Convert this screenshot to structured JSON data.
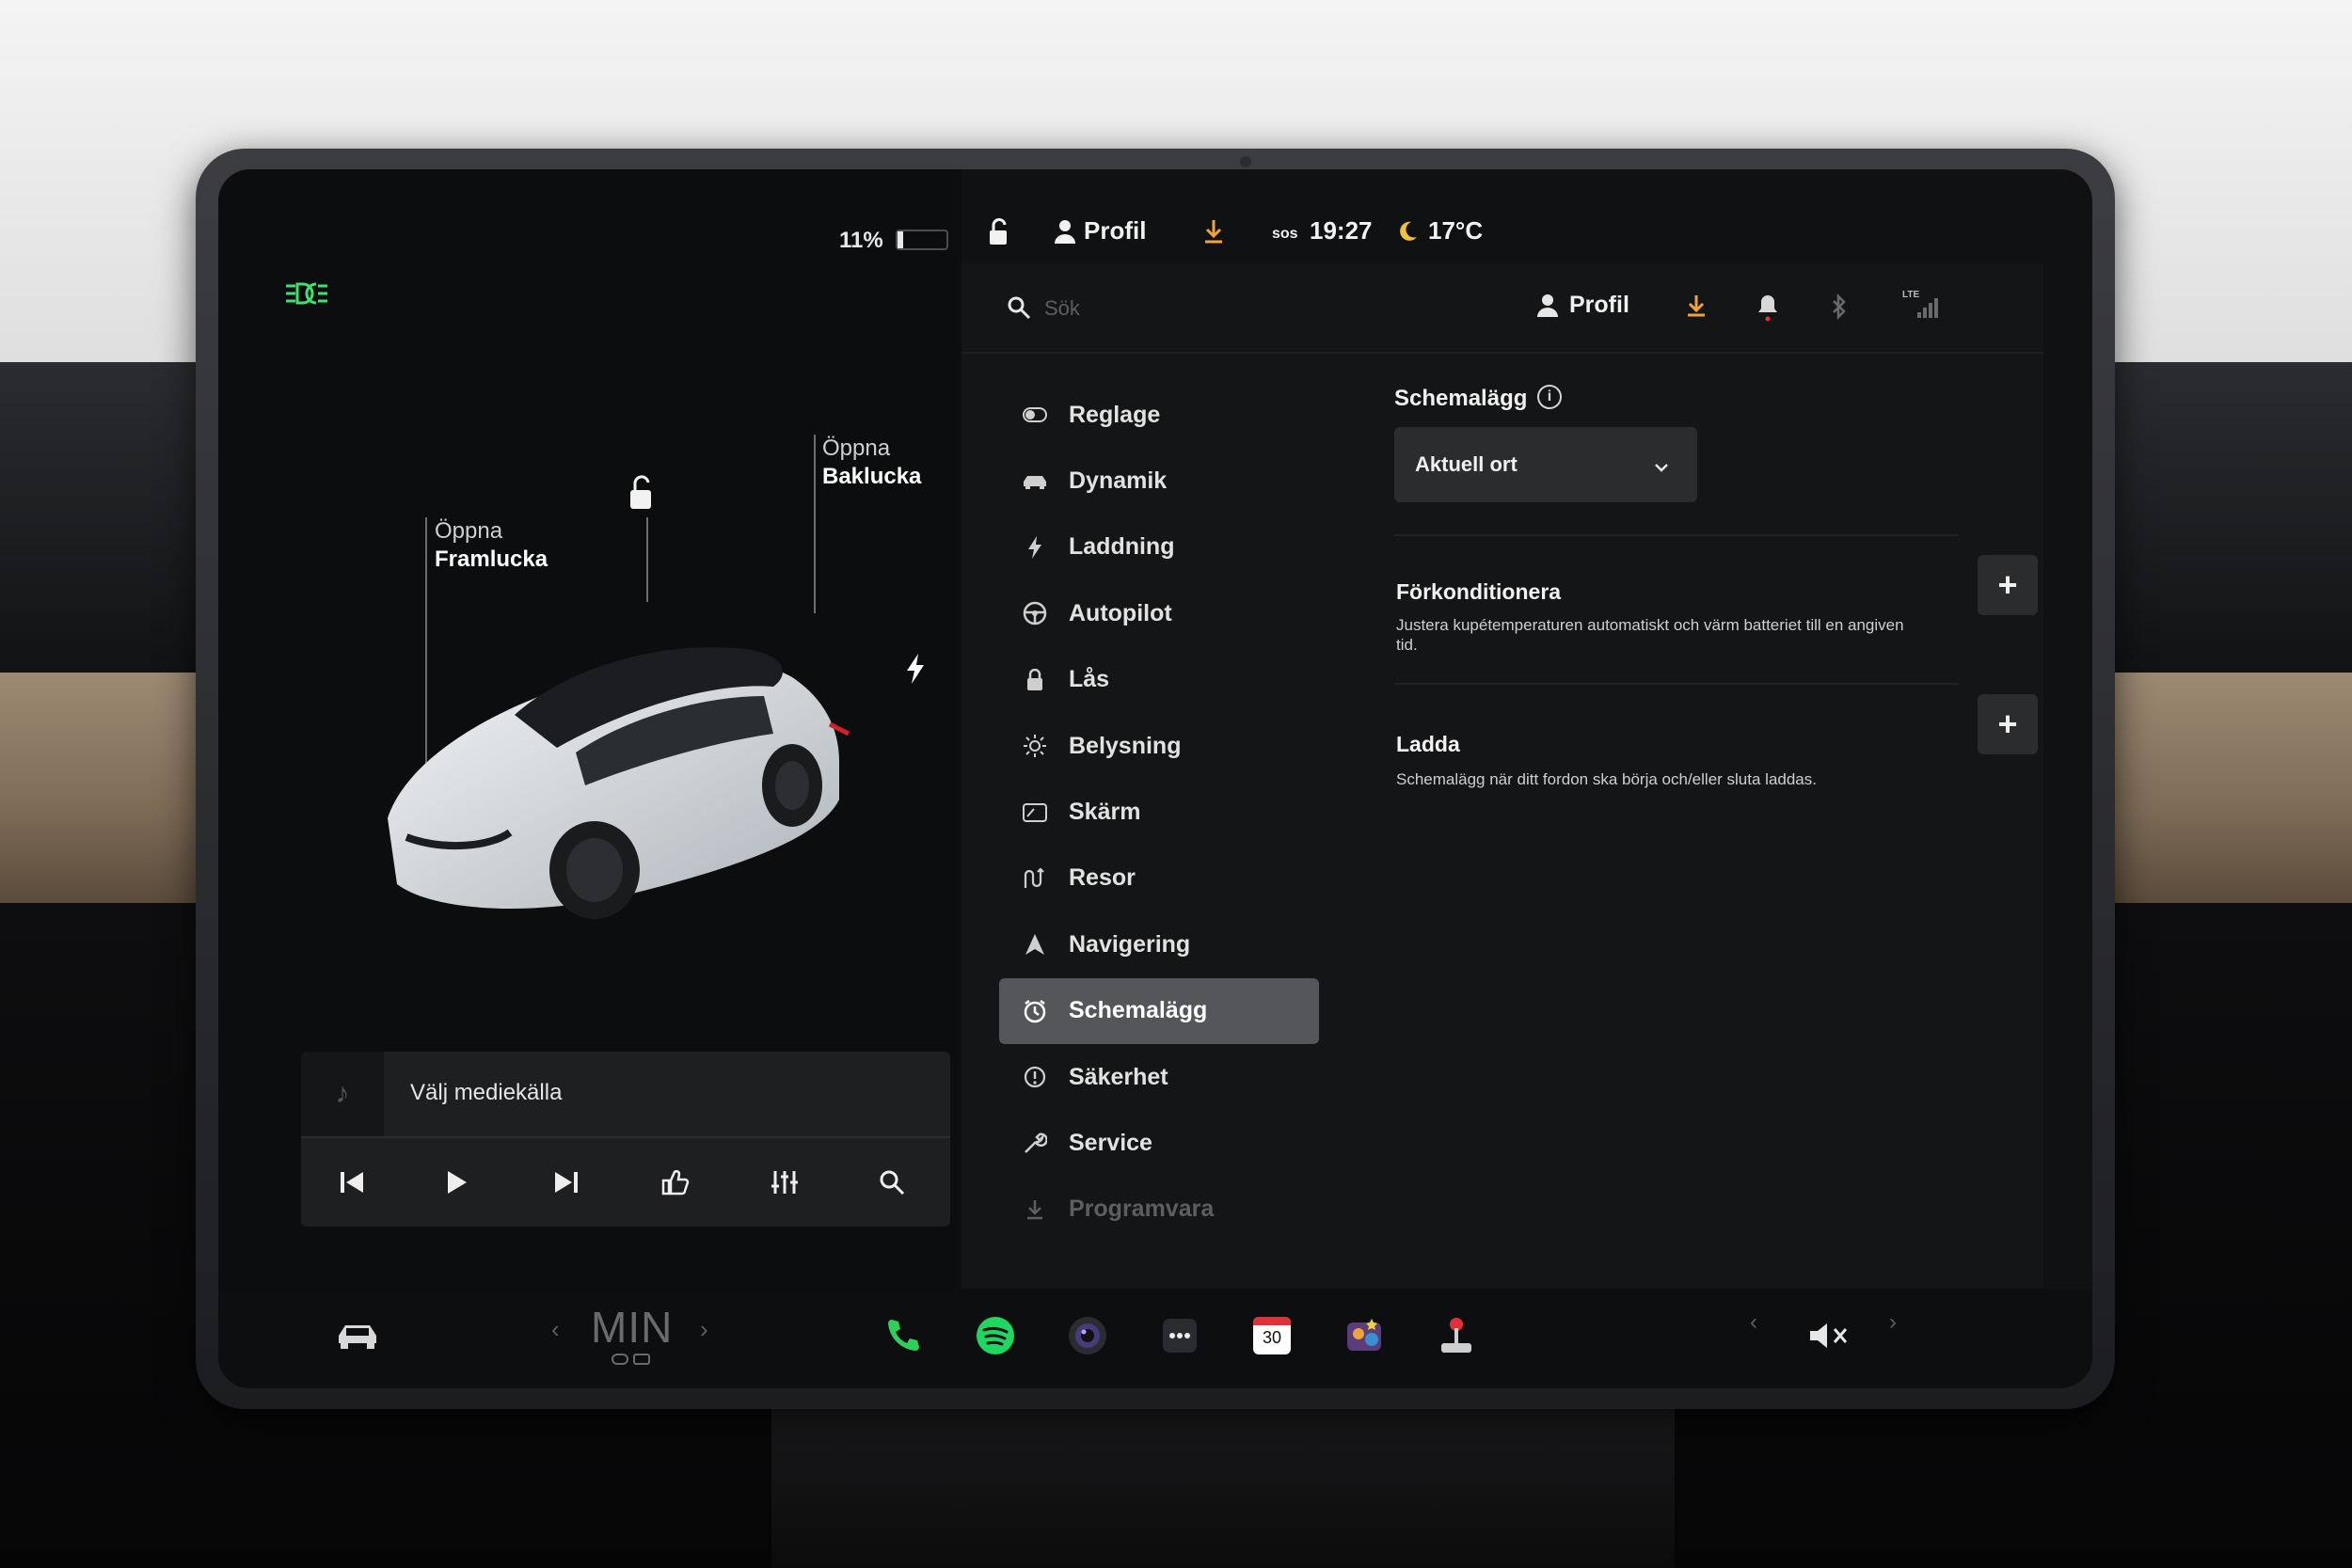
{
  "vehicle": {
    "battery_percent": "11%",
    "battery_level": 0.11,
    "frunk_label_line1": "Öppna",
    "frunk_label_line2": "Framlucka",
    "trunk_label_line1": "Öppna",
    "trunk_label_line2": "Baklucka"
  },
  "media": {
    "title": "Välj mediekälla"
  },
  "status_bar": {
    "profile": "Profil",
    "sos": "sos",
    "time": "19:27",
    "temperature": "17°C"
  },
  "settings_header": {
    "search_placeholder": "Sök",
    "profile": "Profil",
    "network": "LTE"
  },
  "menu": {
    "items": [
      {
        "label": "Reglage",
        "icon": "toggle-icon"
      },
      {
        "label": "Dynamik",
        "icon": "car-icon"
      },
      {
        "label": "Laddning",
        "icon": "bolt-icon"
      },
      {
        "label": "Autopilot",
        "icon": "steering-wheel-icon"
      },
      {
        "label": "Lås",
        "icon": "lock-icon"
      },
      {
        "label": "Belysning",
        "icon": "sun-icon"
      },
      {
        "label": "Skärm",
        "icon": "display-icon"
      },
      {
        "label": "Resor",
        "icon": "trips-icon"
      },
      {
        "label": "Navigering",
        "icon": "navigation-icon"
      },
      {
        "label": "Schemalägg",
        "icon": "clock-icon"
      },
      {
        "label": "Säkerhet",
        "icon": "safety-icon"
      },
      {
        "label": "Service",
        "icon": "wrench-icon"
      },
      {
        "label": "Programvara",
        "icon": "download-icon"
      }
    ],
    "active": "Schemalägg"
  },
  "schedule": {
    "title": "Schemalägg",
    "location_selected": "Aktuell ort",
    "precondition_title": "Förkonditionera",
    "precondition_desc": "Justera kupétemperaturen automatiskt och värm batteriet till en angiven tid.",
    "charge_title": "Ladda",
    "charge_desc": "Schemalägg när ditt fordon ska börja och/eller sluta laddas."
  },
  "dock": {
    "climate_mode": "MIN",
    "calendar_day": "30"
  },
  "colors": {
    "headlight_green": "#3ee06f",
    "download_orange": "#f0a33a",
    "phone_green": "#2fcf5a",
    "spotify_green": "#1ed760",
    "active_menu_bg": "#545659"
  }
}
